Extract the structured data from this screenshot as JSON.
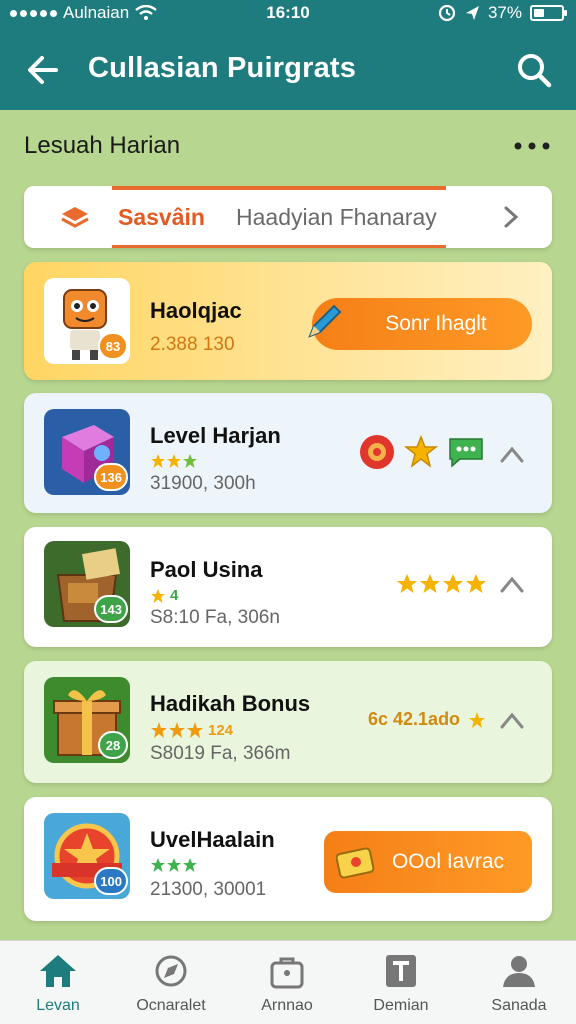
{
  "status_bar": {
    "carrier": "Aulnaian",
    "time": "16:10",
    "battery": "37%",
    "battery_level": 0.37
  },
  "header": {
    "title": "Cullasian Puirgrats"
  },
  "section": {
    "title": "Lesuah Harian"
  },
  "tabs": {
    "active": "Sasvâin",
    "rest": "Haadyian Fhanaray"
  },
  "cards": [
    {
      "name": "Haolqjac",
      "sub": "2.388 130",
      "badge": "83",
      "button": "Sonr Ihaglt"
    },
    {
      "name": "Level Harjan",
      "sub": "31900, 300h",
      "badge": "136"
    },
    {
      "name": "Paol Usina",
      "sub": "S8:10 Fa, 306n",
      "badge": "143",
      "rating": "4"
    },
    {
      "name": "Hadikah Bonus",
      "sub": "S8019 Fa, 366m",
      "badge": "28",
      "tag": "6c 42.1ado",
      "rating_text": "124"
    },
    {
      "name": "UvelHaalain",
      "sub": "21300, 30001",
      "badge": "100",
      "button": "OOol Iavrac"
    }
  ],
  "nav": [
    {
      "label": "Levan"
    },
    {
      "label": "Ocnaralet"
    },
    {
      "label": "Arnnao"
    },
    {
      "label": "Demian"
    },
    {
      "label": "Sanada"
    }
  ],
  "colors": {
    "header": "#1f7c7e",
    "accent": "#f57f17",
    "background": "#b7d68f"
  }
}
